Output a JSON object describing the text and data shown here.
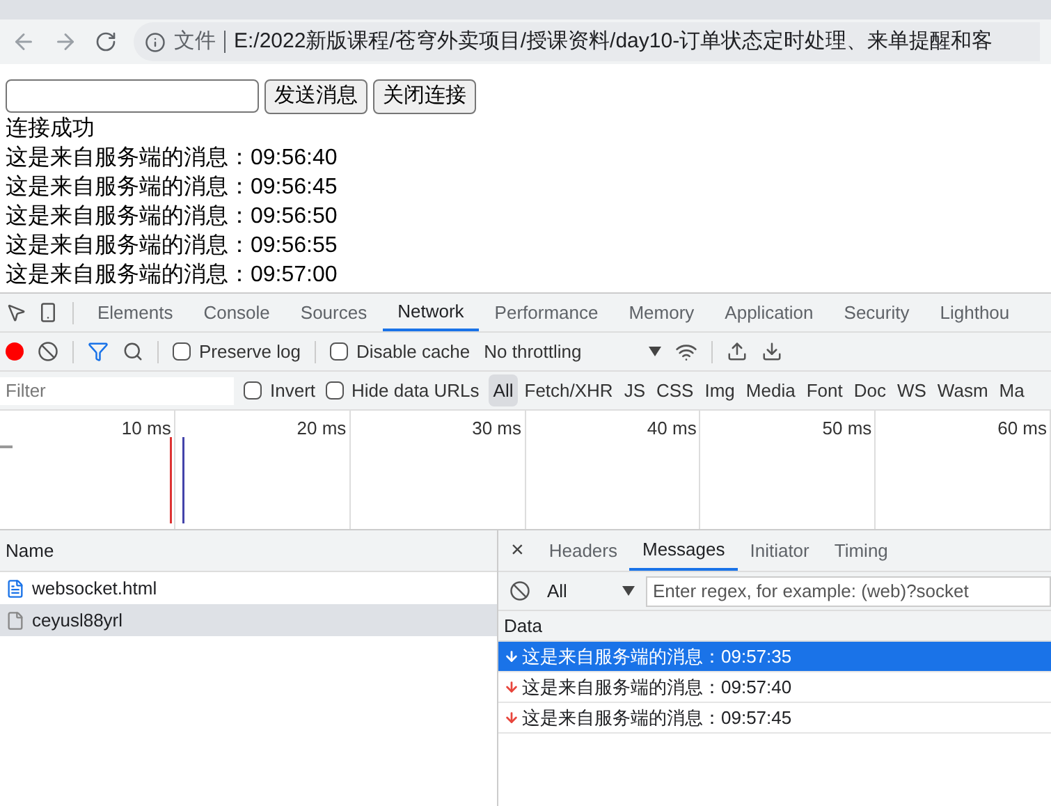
{
  "browser": {
    "address": {
      "scheme": "文件",
      "url": "E:/2022新版课程/苍穹外卖项目/授课资料/day10-订单状态定时处理、来单提醒和客"
    }
  },
  "page": {
    "buttons": [
      "发送消息",
      "关闭连接"
    ],
    "lines": [
      "连接成功",
      "这是来自服务端的消息：09:56:40",
      "这是来自服务端的消息：09:56:45",
      "这是来自服务端的消息：09:56:50",
      "这是来自服务端的消息：09:56:55",
      "这是来自服务端的消息：09:57:00"
    ]
  },
  "devtools": {
    "tabs": [
      {
        "label": "Elements",
        "selected": false
      },
      {
        "label": "Console",
        "selected": false
      },
      {
        "label": "Sources",
        "selected": false
      },
      {
        "label": "Network",
        "selected": true
      },
      {
        "label": "Performance",
        "selected": false
      },
      {
        "label": "Memory",
        "selected": false
      },
      {
        "label": "Application",
        "selected": false
      },
      {
        "label": "Security",
        "selected": false
      },
      {
        "label": "Lighthou",
        "selected": false
      }
    ],
    "toolbar": {
      "recording": true,
      "preserve_log": {
        "label": "Preserve log",
        "checked": false
      },
      "disable_cache": {
        "label": "Disable cache",
        "checked": false
      },
      "throttling": "No throttling"
    },
    "filter": {
      "placeholder": "Filter",
      "invert": {
        "label": "Invert",
        "checked": false
      },
      "hide_data_urls": {
        "label": "Hide data URLs",
        "checked": false
      },
      "types": [
        {
          "label": "All",
          "selected": true
        },
        {
          "label": "Fetch/XHR",
          "selected": false
        },
        {
          "label": "JS",
          "selected": false
        },
        {
          "label": "CSS",
          "selected": false
        },
        {
          "label": "Img",
          "selected": false
        },
        {
          "label": "Media",
          "selected": false
        },
        {
          "label": "Font",
          "selected": false
        },
        {
          "label": "Doc",
          "selected": false
        },
        {
          "label": "WS",
          "selected": false
        },
        {
          "label": "Wasm",
          "selected": false
        },
        {
          "label": "Ma",
          "selected": false
        }
      ]
    },
    "timeline": {
      "ticks": [
        "10 ms",
        "20 ms",
        "30 ms",
        "40 ms",
        "50 ms",
        "60 ms"
      ]
    },
    "requests": {
      "header": "Name",
      "rows": [
        {
          "name": "websocket.html",
          "kind": "document",
          "selected": false
        },
        {
          "name": "ceyusl88yrl",
          "kind": "websocket",
          "selected": true
        }
      ]
    },
    "detail": {
      "close": "×",
      "tabs": [
        {
          "label": "Headers",
          "selected": false
        },
        {
          "label": "Messages",
          "selected": true
        },
        {
          "label": "Initiator",
          "selected": false
        },
        {
          "label": "Timing",
          "selected": false
        }
      ],
      "type_filter": "All",
      "regex": {
        "placeholder": "Enter regex, for example: (web)?socket"
      },
      "column": "Data",
      "messages": [
        {
          "text": "这是来自服务端的消息：09:57:35",
          "selected": true
        },
        {
          "text": "这是来自服务端的消息：09:57:40",
          "selected": false
        },
        {
          "text": "这是来自服务端的消息：09:57:45",
          "selected": false
        }
      ]
    }
  }
}
